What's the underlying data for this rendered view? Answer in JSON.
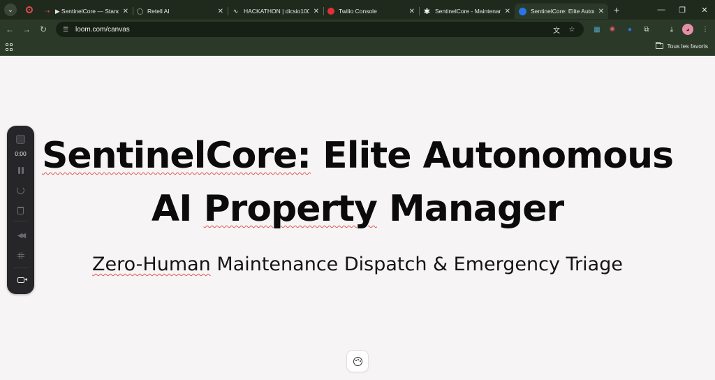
{
  "browser": {
    "tabs": [
      {
        "title": "▶ SentinelCore — Standa",
        "favicon": "video-arrow-icon",
        "active": false
      },
      {
        "title": "Retell AI",
        "favicon": "retell-icon",
        "active": false
      },
      {
        "title": "HACKATHON | dicsio100",
        "favicon": "waveform-icon",
        "active": false
      },
      {
        "title": "Twilio Console",
        "favicon": "twilio-icon",
        "active": false
      },
      {
        "title": "SentinelCore - Maintenan",
        "favicon": "asterisk-icon",
        "active": false
      },
      {
        "title": "SentinelCore: Elite Autono",
        "favicon": "loom-icon",
        "active": true
      }
    ],
    "close_glyph": "✕",
    "new_tab_glyph": "+",
    "address": "loom.com/canvas",
    "bookmarks_label": "Tous les favoris",
    "theme_color": "#2b3a28"
  },
  "loom_controls": {
    "timer": "0:00",
    "record_accent": "#e04a4a"
  },
  "slide": {
    "title_line1_word1": "SentinelCore:",
    "title_line1_rest": " Elite Autonomous",
    "title_line2_prefix": "AI ",
    "title_line2_word": "Property",
    "title_line2_rest": " Manager",
    "subtitle_word1": "Zero-Human",
    "subtitle_rest": " Maintenance Dispatch & Emergency Triage",
    "spellcheck_color": "#e05555"
  }
}
